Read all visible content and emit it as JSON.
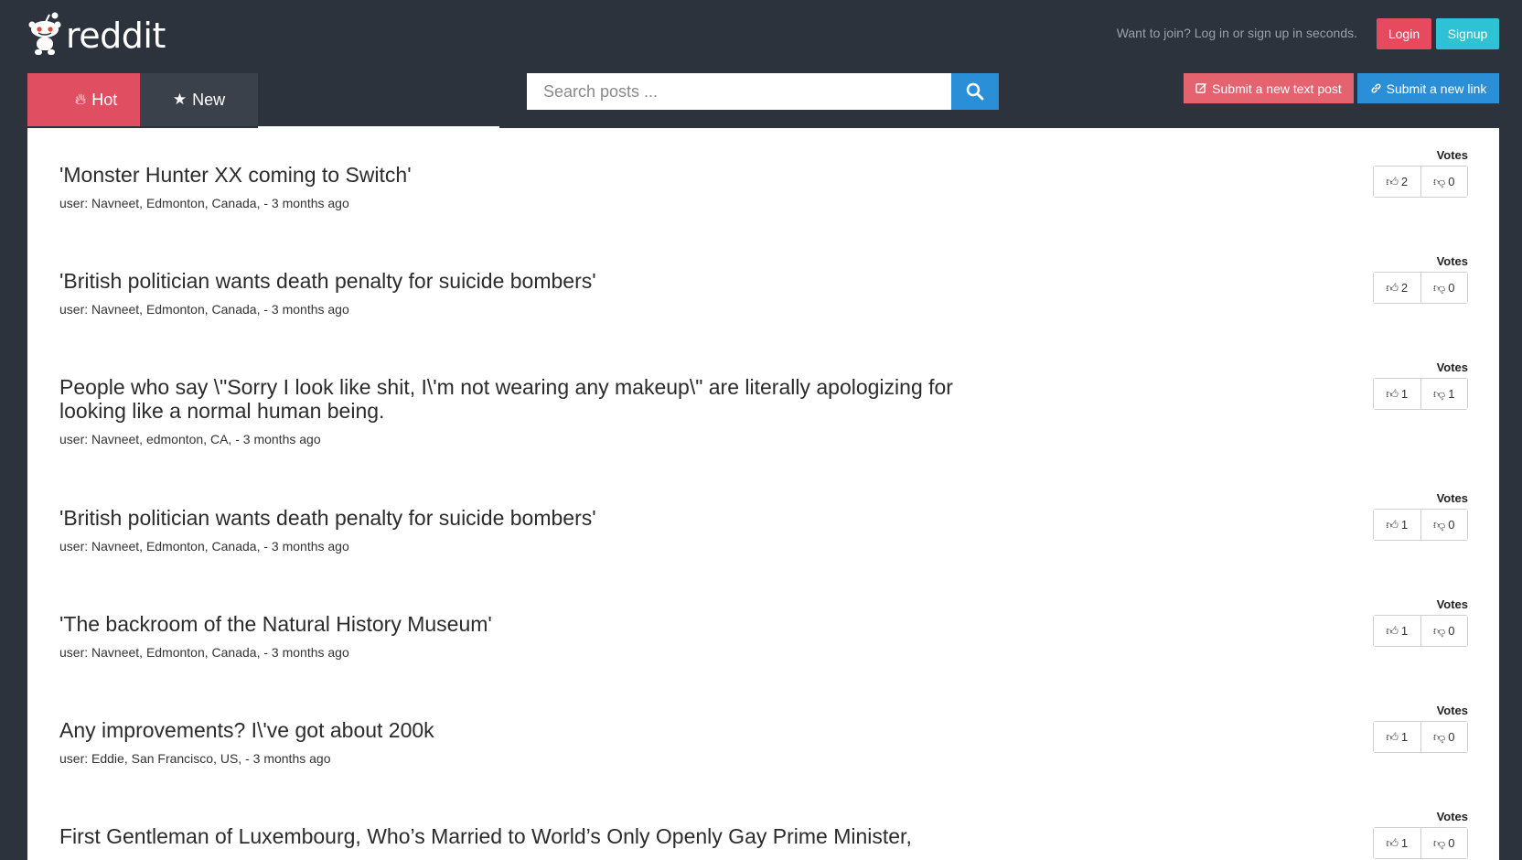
{
  "header": {
    "logo_text": "reddit",
    "join_text": "Want to join? Log in or sign up in seconds.",
    "login_label": "Login",
    "signup_label": "Signup"
  },
  "tabs": [
    {
      "label": "Hot",
      "icon": "fire-icon",
      "active": true
    },
    {
      "label": "New",
      "icon": "star-icon",
      "active": false
    }
  ],
  "search": {
    "placeholder": "Search posts ..."
  },
  "actions": {
    "text_post_label": "Submit a new text post",
    "link_label": "Submit a new link"
  },
  "votes_label": "Votes",
  "posts": [
    {
      "title": "'Monster Hunter XX coming to Switch'",
      "meta": "user: Navneet, Edmonton, Canada, - 3 months ago",
      "up": "2",
      "down": "0"
    },
    {
      "title": "'British politician wants death penalty for suicide bombers'",
      "meta": "user: Navneet, Edmonton, Canada, - 3 months ago",
      "up": "2",
      "down": "0"
    },
    {
      "title": "People who say \\\"Sorry I look like shit, I\\'m not wearing any makeup\\\" are literally apologizing for looking like a normal human being.",
      "meta": "user: Navneet, edmonton, CA, - 3 months ago",
      "up": "1",
      "down": "1"
    },
    {
      "title": "'British politician wants death penalty for suicide bombers'",
      "meta": "user: Navneet, Edmonton, Canada, - 3 months ago",
      "up": "1",
      "down": "0"
    },
    {
      "title": "'The backroom of the Natural History Museum'",
      "meta": "user: Navneet, Edmonton, Canada, - 3 months ago",
      "up": "1",
      "down": "0"
    },
    {
      "title": "Any improvements? I\\'ve got about 200k",
      "meta": "user: Eddie, San Francisco, US, - 3 months ago",
      "up": "1",
      "down": "0"
    },
    {
      "title": "First Gentleman of Luxembourg, Who’s Married to World’s Only Openly Gay Prime Minister,",
      "meta": "",
      "up": "1",
      "down": "0"
    }
  ],
  "colors": {
    "background": "#2d333c",
    "hot_tab": "#e04e61",
    "login": "#e74a5e",
    "signup": "#2ec3d4",
    "primary_blue": "#2b8fd8"
  }
}
